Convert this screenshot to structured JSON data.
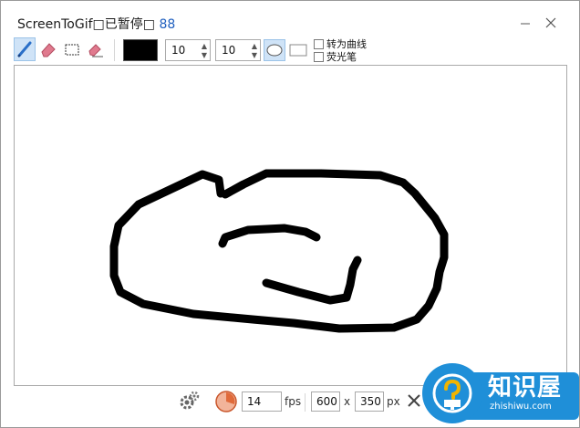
{
  "window": {
    "title": "ScreenToGif□已暂停□",
    "frame_count": "88"
  },
  "toolbar": {
    "tools": [
      {
        "name": "pen-tool",
        "active": true
      },
      {
        "name": "eraser-tool",
        "active": false
      },
      {
        "name": "select-tool",
        "active": false
      },
      {
        "name": "remove-all-tool",
        "active": false
      }
    ],
    "color": "#000000",
    "width_value": "10",
    "height_value": "10",
    "shape_ellipse_selected": true,
    "checkbox_curve_label": "转为曲线",
    "checkbox_highlighter_label": "荧光笔"
  },
  "bottom": {
    "fps_value": "14",
    "fps_label": "fps",
    "width_value": "600",
    "times_label": "x",
    "height_value": "350",
    "px_label": "px"
  },
  "watermark": {
    "title": "知识屋",
    "subtitle": "zhishiwu.com",
    "color": "#1f8fd8"
  }
}
